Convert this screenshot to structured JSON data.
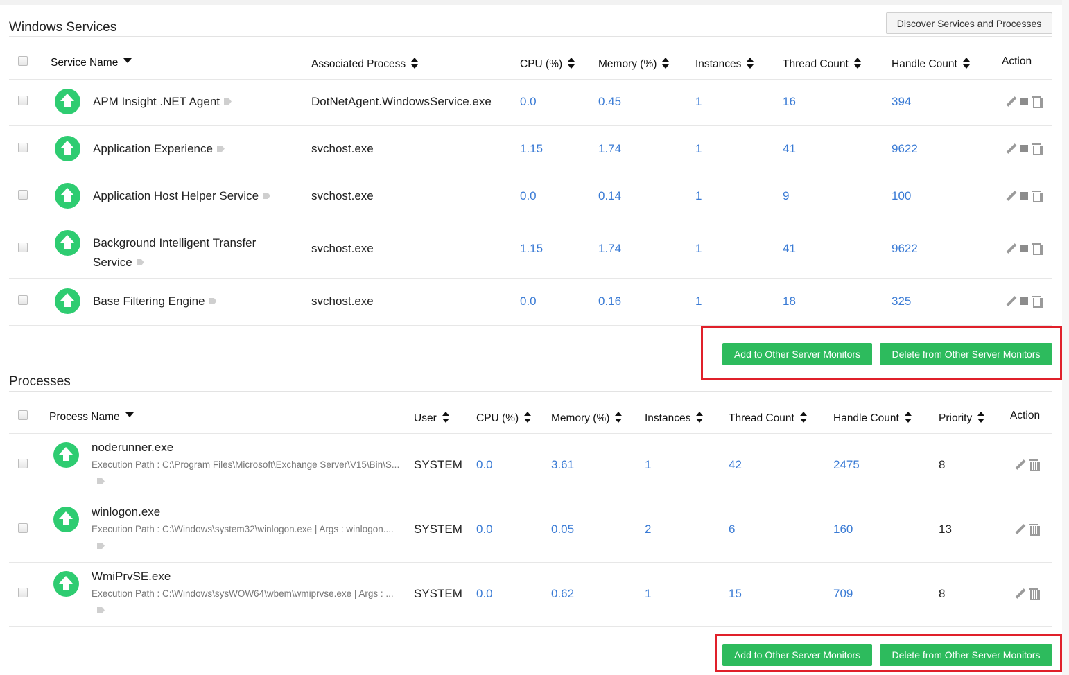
{
  "windows_services": {
    "title": "Windows Services",
    "discover_button": "Discover Services and Processes",
    "columns": [
      "Service Name",
      "Associated Process",
      "CPU (%)",
      "Memory (%)",
      "Instances",
      "Thread Count",
      "Handle Count",
      "Action"
    ],
    "rows": [
      {
        "name": "APM Insight .NET Agent",
        "name2": "",
        "process": "DotNetAgent.WindowsService.exe",
        "cpu": "0.0",
        "memory": "0.45",
        "instances": "1",
        "threads": "16",
        "handles": "394"
      },
      {
        "name": "Application Experience",
        "name2": "",
        "process": "svchost.exe",
        "cpu": "1.15",
        "memory": "1.74",
        "instances": "1",
        "threads": "41",
        "handles": "9622"
      },
      {
        "name": "Application Host Helper Service",
        "name2": "",
        "process": "svchost.exe",
        "cpu": "0.0",
        "memory": "0.14",
        "instances": "1",
        "threads": "9",
        "handles": "100"
      },
      {
        "name": "Background Intelligent Transfer",
        "name2": "Service",
        "process": "svchost.exe",
        "cpu": "1.15",
        "memory": "1.74",
        "instances": "1",
        "threads": "41",
        "handles": "9622"
      },
      {
        "name": "Base Filtering Engine",
        "name2": "",
        "process": "svchost.exe",
        "cpu": "0.0",
        "memory": "0.16",
        "instances": "1",
        "threads": "18",
        "handles": "325"
      }
    ],
    "add_button": "Add to Other Server Monitors",
    "delete_button": "Delete from Other Server Monitors"
  },
  "processes": {
    "title": "Processes",
    "columns": [
      "Process Name",
      "User",
      "CPU (%)",
      "Memory (%)",
      "Instances",
      "Thread Count",
      "Handle Count",
      "Priority",
      "Action"
    ],
    "rows": [
      {
        "name": "noderunner.exe",
        "path": "Execution Path : C:\\Program Files\\Microsoft\\Exchange Server\\V15\\Bin\\S...",
        "user": "SYSTEM",
        "cpu": "0.0",
        "memory": "3.61",
        "instances": "1",
        "threads": "42",
        "handles": "2475",
        "priority": "8"
      },
      {
        "name": "winlogon.exe",
        "path": "Execution Path : C:\\Windows\\system32\\winlogon.exe | Args : winlogon....",
        "user": "SYSTEM",
        "cpu": "0.0",
        "memory": "0.05",
        "instances": "2",
        "threads": "6",
        "handles": "160",
        "priority": "13"
      },
      {
        "name": "WmiPrvSE.exe",
        "path": "Execution Path : C:\\Windows\\sysWOW64\\wbem\\wmiprvse.exe | Args : ...",
        "user": "SYSTEM",
        "cpu": "0.0",
        "memory": "0.62",
        "instances": "1",
        "threads": "15",
        "handles": "709",
        "priority": "8"
      }
    ],
    "add_button": "Add to Other Server Monitors",
    "delete_button": "Delete from Other Server Monitors"
  },
  "colors": {
    "accent_green": "#2dbb5d",
    "link_blue": "#3a7bd5",
    "highlight_red": "#e0202a",
    "status_up": "#2ecc71"
  }
}
